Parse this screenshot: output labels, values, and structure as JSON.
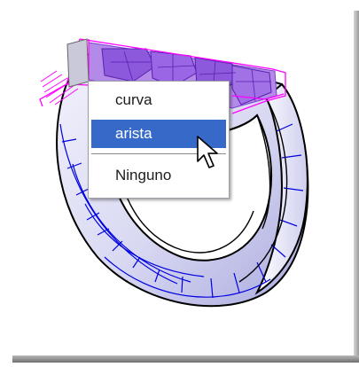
{
  "context_menu": {
    "items": [
      {
        "label": "curva",
        "selected": false
      },
      {
        "label": "arista",
        "selected": true
      },
      {
        "label": "Ninguno",
        "selected": false
      }
    ]
  },
  "colors": {
    "ring_fill": "#dcdcf4",
    "ring_shade": "#a8a8dc",
    "wire_blue": "#0000e0",
    "outline_black": "#000000",
    "selection_magenta": "#ff00ff",
    "gem_purple": "#9a66e6",
    "menu_highlight": "#3769c8"
  },
  "icons": [
    "arrow-cursor-icon"
  ]
}
